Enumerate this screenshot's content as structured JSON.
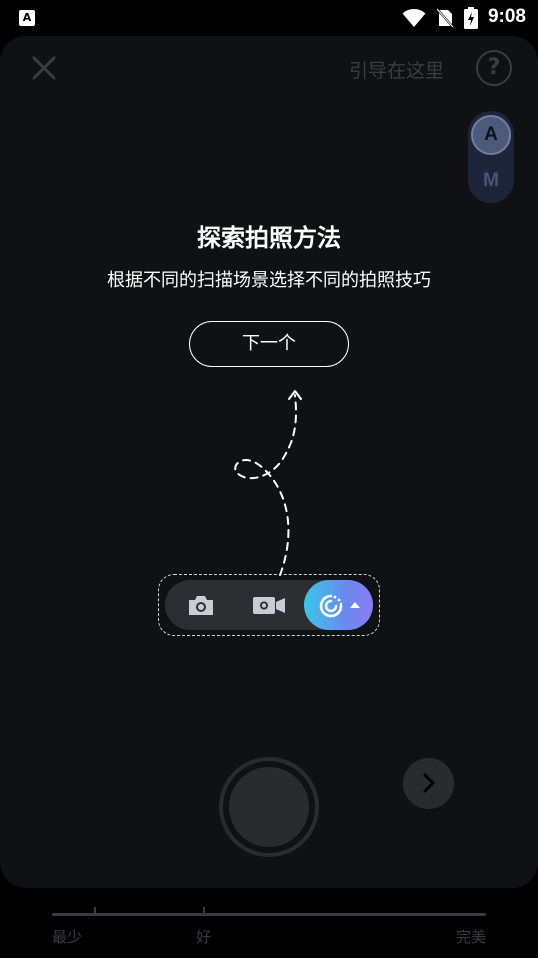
{
  "status_bar": {
    "app_icon_letter": "A",
    "time": "9:08"
  },
  "header": {
    "guide_link": "引导在这里",
    "help_symbol": "?"
  },
  "mode_toggle": {
    "option_a": "A",
    "option_m": "M",
    "selected": "A"
  },
  "guide": {
    "title": "探索拍照方法",
    "description": "根据不同的扫描场景选择不同的拍照技巧",
    "next_label": "下一个"
  },
  "mode_selector": {
    "modes": [
      "photo-icon",
      "video-icon",
      "smart-scan-icon"
    ],
    "selected": "smart-scan-icon",
    "accent_gradient": [
      "#39c6e8",
      "#8b7cf2"
    ]
  },
  "quality_slider": {
    "labels": [
      "最少",
      "好",
      "完美"
    ]
  },
  "colors": {
    "panel_background": "#101112",
    "dimmed_text": "#3a3c40"
  }
}
